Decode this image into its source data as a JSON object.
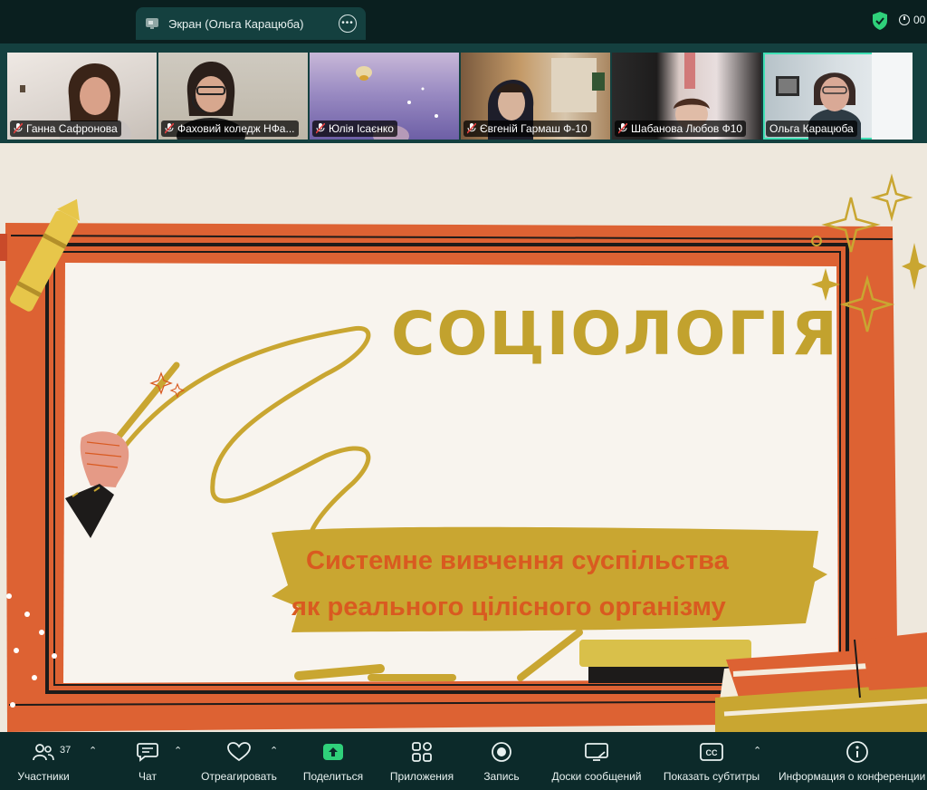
{
  "topbar": {
    "screen_tab_title": "Экран (Ольга Карацюба)",
    "timer": "00"
  },
  "participants": [
    {
      "name": "Ганна Сафронова",
      "muted": true
    },
    {
      "name": "Фаховий коледж НФа...",
      "muted": true
    },
    {
      "name": "Юлія Ісаєнко",
      "muted": true
    },
    {
      "name": "Євгеній Гармаш Ф-10",
      "muted": true
    },
    {
      "name": "Шабанова Любов Ф10",
      "muted": true
    },
    {
      "name": "Ольга Карацюба",
      "muted": false,
      "active_speaker": true
    }
  ],
  "slide": {
    "title": "СОЦІОЛОГІЯ",
    "subtitle_line1": "Системне вивчення суспільства",
    "subtitle_line2": "як реального цілісного організму",
    "colors": {
      "board": "#dd6233",
      "title": "#c2a22e",
      "subtitle": "#d95a20",
      "banner": "#c9a631",
      "background": "#eee8dd"
    }
  },
  "toolbar": {
    "participants_label": "Участники",
    "participants_count": "37",
    "chat_label": "Чат",
    "react_label": "Отреагировать",
    "share_label": "Поделиться",
    "apps_label": "Приложения",
    "record_label": "Запись",
    "whiteboards_label": "Доски сообщений",
    "captions_label": "Показать субтитры",
    "info_label": "Информация о конференции"
  },
  "icons": [
    "screen-icon",
    "more-icon",
    "shield-check-icon",
    "clock-icon",
    "mic-muted-icon",
    "participants-icon",
    "chat-icon",
    "heart-icon",
    "share-arrow-icon",
    "apps-icon",
    "record-icon",
    "whiteboard-icon",
    "cc-icon",
    "info-icon",
    "caret-up-icon"
  ]
}
